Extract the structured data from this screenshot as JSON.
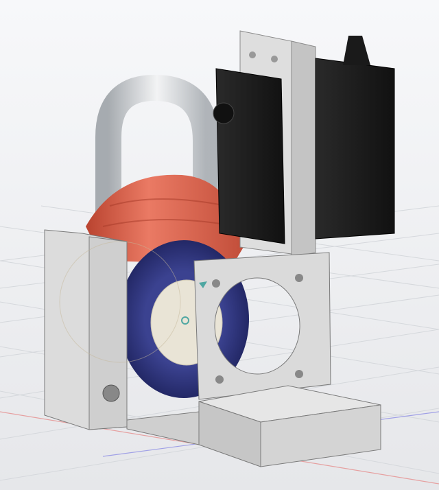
{
  "viewport": {
    "colors": {
      "background_top": "#f7f8fa",
      "background_bottom": "#e9eaed",
      "grid": "#d3d6db",
      "x_axis": "#e08080",
      "y_axis": "#8080e0",
      "body_gray": "#d9d9d9",
      "servo_black": "#1c1c1c",
      "spool_red": "#d8634f",
      "disk_blue": "#2e3373",
      "inner_cream": "#e9e4d6",
      "shackle_silver": "#c9ccd0",
      "pivot_marker": "#4fa7a2"
    }
  }
}
